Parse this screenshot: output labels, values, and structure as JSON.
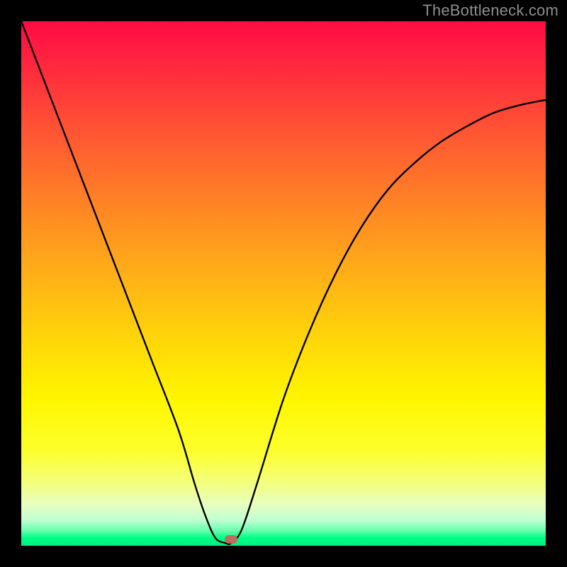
{
  "watermark": "TheBottleneck.com",
  "chart_data": {
    "type": "line",
    "title": "",
    "xlabel": "",
    "ylabel": "",
    "xlim": [
      0,
      100
    ],
    "ylim": [
      0,
      100
    ],
    "grid": false,
    "series": [
      {
        "name": "bottleneck-curve",
        "x": [
          0,
          5,
          10,
          15,
          20,
          25,
          30,
          33,
          35,
          37,
          39,
          40,
          42,
          45,
          50,
          55,
          60,
          65,
          70,
          75,
          80,
          85,
          90,
          95,
          100
        ],
        "values": [
          100,
          87,
          74,
          61,
          48,
          35,
          22,
          12,
          6,
          1.5,
          0.5,
          0.5,
          3,
          12,
          28,
          41,
          52,
          61,
          68,
          73,
          77,
          80,
          82.5,
          84,
          85
        ]
      }
    ],
    "optimum_marker": {
      "x": 40,
      "y": 1.2
    },
    "colors": {
      "curve": "#000000",
      "marker": "#bf6c60",
      "background_top": "#ff0b42",
      "background_bottom": "#00f07d"
    }
  }
}
